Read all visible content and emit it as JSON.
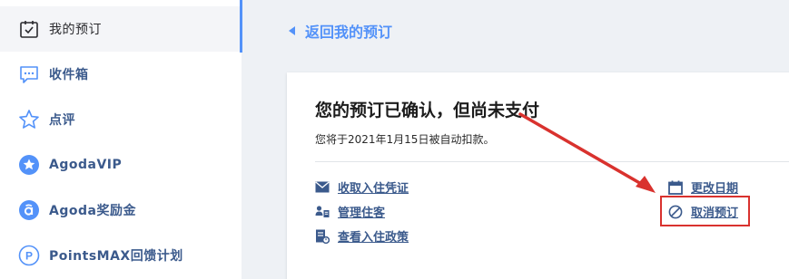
{
  "sidebar": {
    "items": [
      {
        "label": "我的预订",
        "icon": "calendar-check-icon"
      },
      {
        "label": "收件箱",
        "icon": "chat-icon"
      },
      {
        "label": "点评",
        "icon": "star-outline-icon"
      },
      {
        "label": "AgodaVIP",
        "icon": "vip-star-icon"
      },
      {
        "label": "Agoda奖励金",
        "icon": "agoda-cash-icon"
      },
      {
        "label": "PointsMAX回馈计划",
        "icon": "pointsmax-icon"
      }
    ]
  },
  "back": {
    "label": "返回我的预订"
  },
  "booking": {
    "title": "您的预订已确认，但尚未支付",
    "subtitle": "您将于2021年1月15日被自动扣款。",
    "actions_left": [
      {
        "label": "收取入住凭证",
        "icon": "envelope-icon"
      },
      {
        "label": "管理住客",
        "icon": "guest-icon"
      },
      {
        "label": "查看入住政策",
        "icon": "policy-icon"
      }
    ],
    "actions_right": [
      {
        "label": "更改日期",
        "icon": "calendar-icon"
      },
      {
        "label": "取消预订",
        "icon": "cancel-icon"
      }
    ]
  },
  "colors": {
    "accent": "#5392f9",
    "link": "#3b5a8c",
    "annotation": "#d9322e"
  }
}
